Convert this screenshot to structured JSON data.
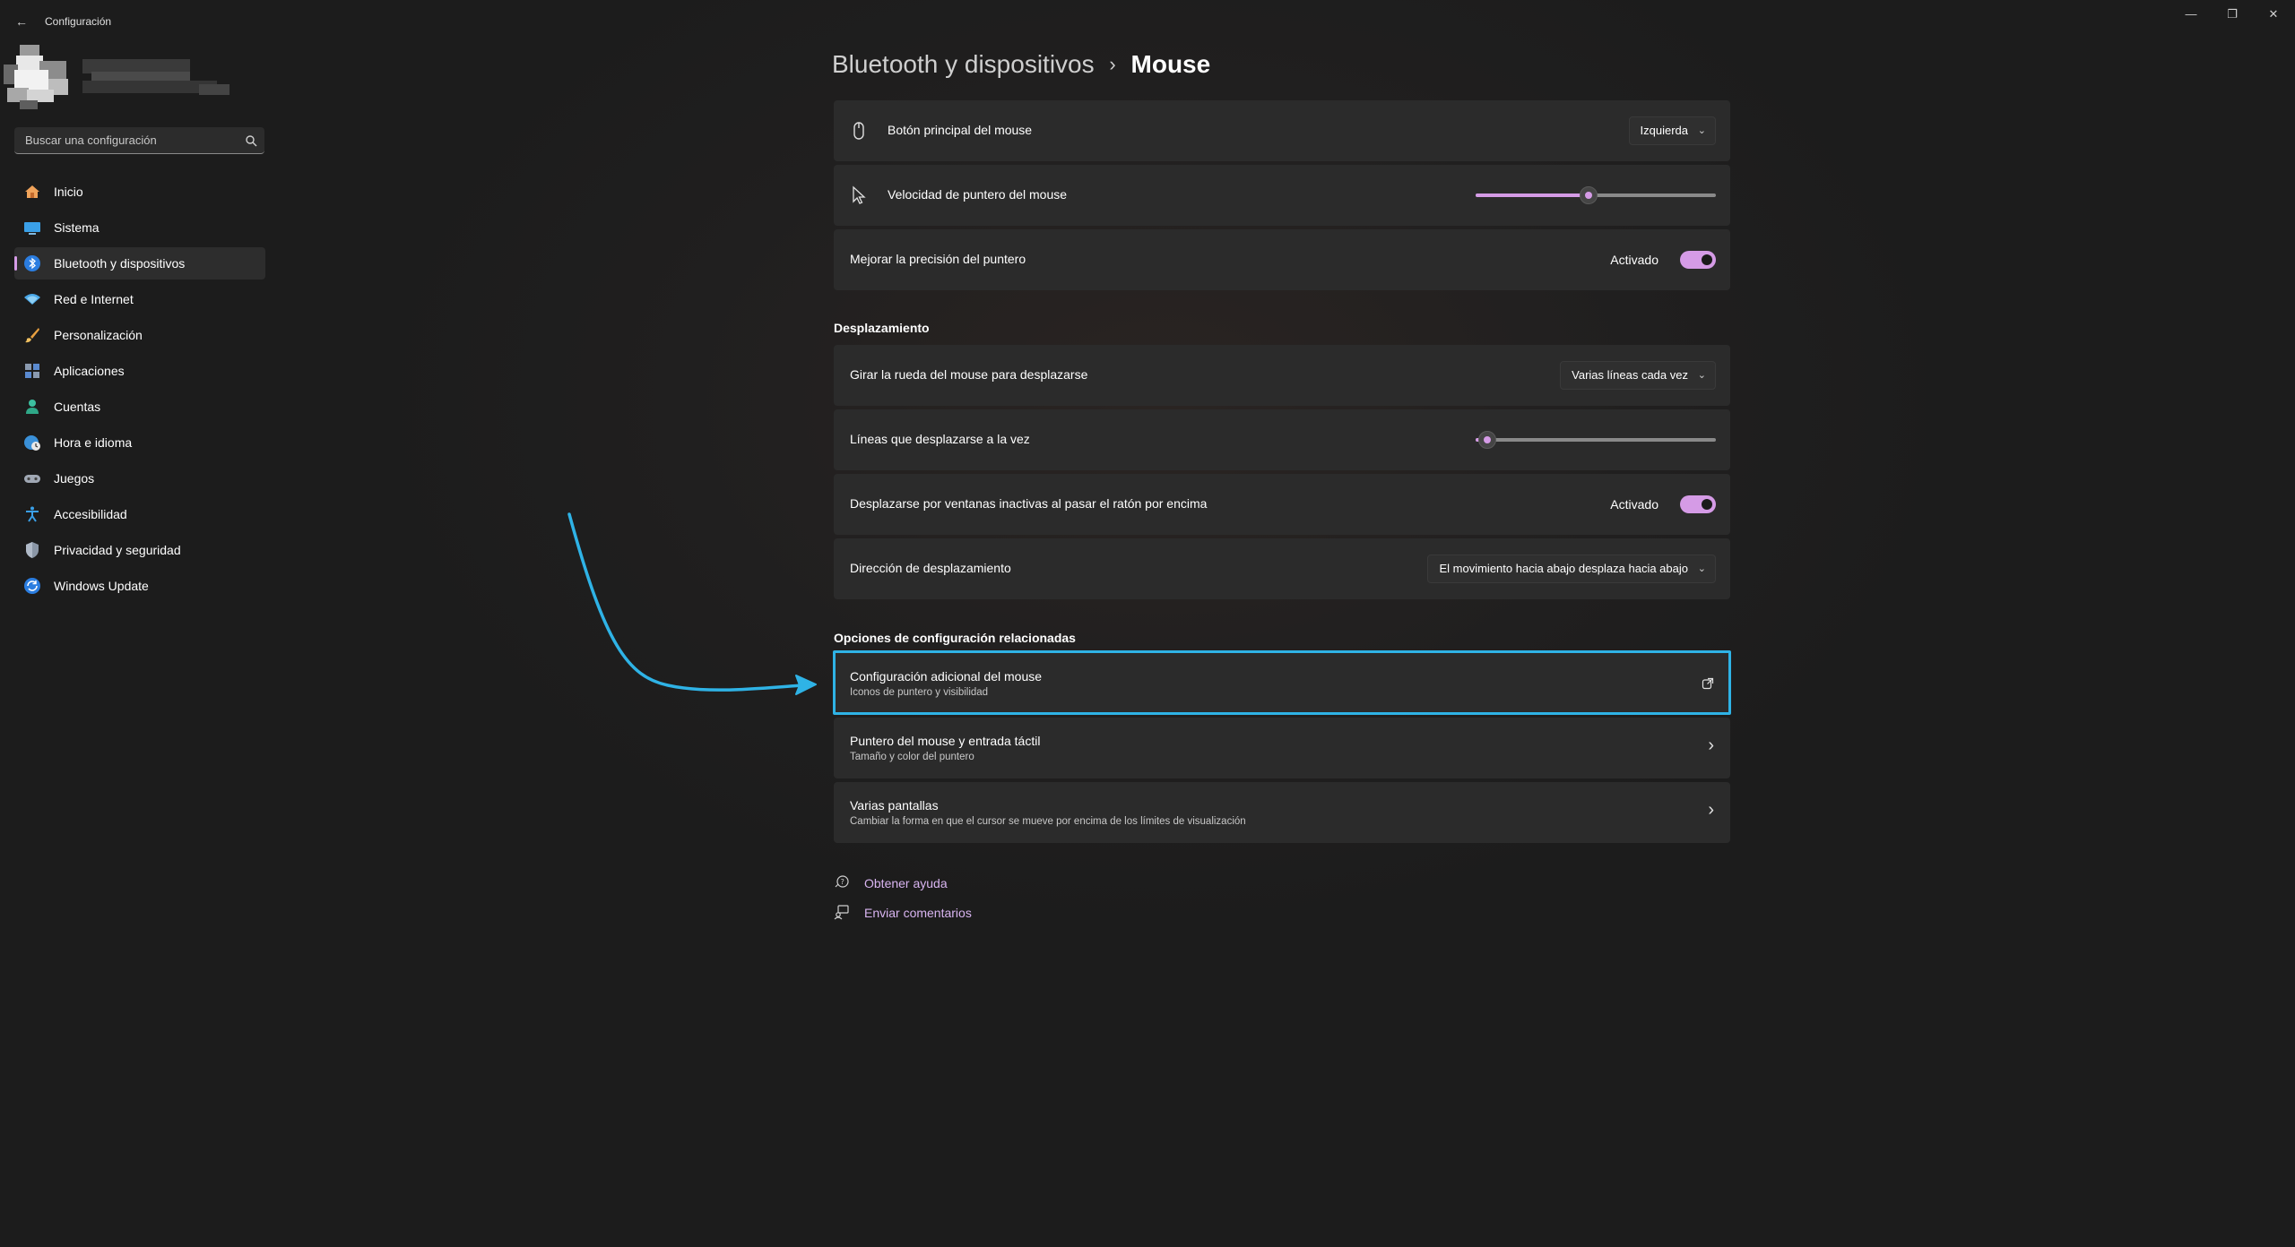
{
  "window": {
    "title": "Configuración",
    "back_glyph": "←",
    "minimize_glyph": "—",
    "maximize_glyph": "❐",
    "close_glyph": "✕"
  },
  "search": {
    "placeholder": "Buscar una configuración",
    "icon": "search-icon"
  },
  "nav": {
    "items": [
      {
        "label": "Inicio",
        "icon": "home-icon",
        "active": false
      },
      {
        "label": "Sistema",
        "icon": "monitor-icon",
        "active": false
      },
      {
        "label": "Bluetooth y dispositivos",
        "icon": "bluetooth-icon",
        "active": true
      },
      {
        "label": "Red e Internet",
        "icon": "wifi-icon",
        "active": false
      },
      {
        "label": "Personalización",
        "icon": "brush-icon",
        "active": false
      },
      {
        "label": "Aplicaciones",
        "icon": "apps-icon",
        "active": false
      },
      {
        "label": "Cuentas",
        "icon": "person-icon",
        "active": false
      },
      {
        "label": "Hora e idioma",
        "icon": "globe-clock-icon",
        "active": false
      },
      {
        "label": "Juegos",
        "icon": "gamepad-icon",
        "active": false
      },
      {
        "label": "Accesibilidad",
        "icon": "accessibility-icon",
        "active": false
      },
      {
        "label": "Privacidad y seguridad",
        "icon": "shield-icon",
        "active": false
      },
      {
        "label": "Windows Update",
        "icon": "update-icon",
        "active": false
      }
    ]
  },
  "breadcrumb": {
    "parent": "Bluetooth y dispositivos",
    "separator": "›",
    "current": "Mouse"
  },
  "mouse_settings": {
    "primary_button": {
      "label": "Botón principal del mouse",
      "value": "Izquierda"
    },
    "pointer_speed": {
      "label": "Velocidad de puntero del mouse",
      "level": 0.47
    },
    "pointer_precision": {
      "label": "Mejorar la precisión del puntero",
      "state": "Activado",
      "on": true
    }
  },
  "scrolling": {
    "title": "Desplazamiento",
    "wheel": {
      "label": "Girar la rueda del mouse para desplazarse",
      "value": "Varias líneas cada vez"
    },
    "lines": {
      "label": "Líneas que desplazarse a la vez",
      "level": 0.05
    },
    "inactive": {
      "label": "Desplazarse por ventanas inactivas al pasar el ratón por encima",
      "state": "Activado",
      "on": true
    },
    "direction": {
      "label": "Dirección de desplazamiento",
      "value": "El movimiento hacia abajo desplaza hacia abajo"
    }
  },
  "related": {
    "title": "Opciones de configuración relacionadas",
    "items": [
      {
        "title": "Configuración adicional del mouse",
        "subtitle": "Iconos de puntero y visibilidad",
        "icon": "open-external-icon"
      },
      {
        "title": "Puntero del mouse y entrada táctil",
        "subtitle": "Tamaño y color del puntero",
        "icon": "chevron-right-icon"
      },
      {
        "title": "Varias pantallas",
        "subtitle": "Cambiar la forma en que el cursor se mueve por encima de los límites de visualización",
        "icon": "chevron-right-icon"
      }
    ]
  },
  "footer": {
    "help": "Obtener ayuda",
    "feedback": "Enviar comentarios"
  },
  "colors": {
    "accent": "#d59be6",
    "highlight": "#2fb3e6",
    "card_bg": "#2b2b2b",
    "app_bg": "#1f1f1f"
  },
  "chevron_down": "⌄",
  "chevron_right": "›"
}
